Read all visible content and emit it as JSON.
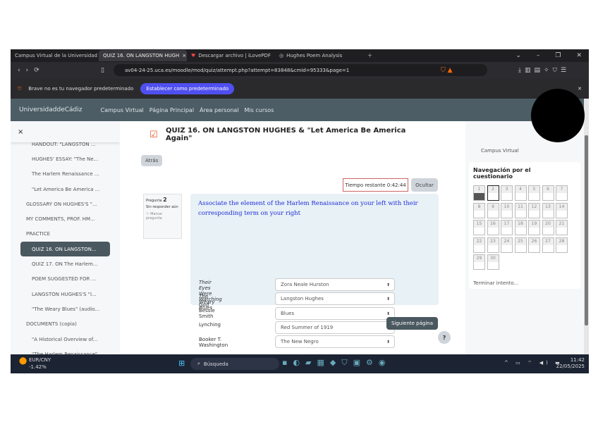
{
  "browser": {
    "tabs": [
      {
        "label": "Campus Virtual de la Universidad d"
      },
      {
        "label": "QUIZ 16. ON LANGSTON HUGH"
      },
      {
        "label": "Descargar archivo | iLovePDF"
      },
      {
        "label": "Hughes Poem Analysis"
      }
    ],
    "url": "av04-24-25.uca.es/moodle/mod/quiz/attempt.php?attempt=83848&cmid=95333&page=1",
    "infobar_text": "Brave no es tu navegador predeterminado",
    "infobar_button": "Establecer como predeterminado"
  },
  "navbar": {
    "brand": "UniversidaddeCádiz",
    "links": [
      "Campus Virtual",
      "Página Principal",
      "Área personal",
      "Mis cursos"
    ]
  },
  "sidebar": {
    "items": [
      {
        "label": "HANDOUT: \"LANGSTON ..."
      },
      {
        "label": "HUGHES' ESSAY: \"The Ne..."
      },
      {
        "label": "The Harlem Renaissance ..."
      },
      {
        "label": "\"Let America Be America ..."
      },
      {
        "label": "GLOSSARY ON HUGHES'S \"..."
      },
      {
        "label": "MY COMMENTS, PROF. HM..."
      },
      {
        "label": "PRACTICE"
      },
      {
        "label": "QUIZ 16. ON LANGSTON..."
      },
      {
        "label": "QUIZ 17. ON The Harlem..."
      },
      {
        "label": "POEM SUGGESTED FOR ..."
      },
      {
        "label": "LANGSTON HUGHES'S \"I..."
      },
      {
        "label": "\"The Weary Blues\" (audio..."
      },
      {
        "label": "DOCUMENTS (copia)"
      },
      {
        "label": "\"A Historical Overview of..."
      },
      {
        "label": "\"The Harlem Renaissance\"..."
      }
    ]
  },
  "quiz": {
    "title": "QUIZ 16. ON LANGSTON HUGHES & \"Let America Be America Again\"",
    "back": "Atrás",
    "timer": "Tiempo restante 0:42:44",
    "hide": "Ocultar",
    "question_label": "Pregunta",
    "question_number": "2",
    "status": "Sin responder aún",
    "flag": "Marcar pregunta",
    "prompt": "Associate the element of the Harlem Renaissance on your left with their corresponding term on your right",
    "rows": [
      {
        "left": "Their Eyes Were Watching God",
        "right": "Zora Neale Hurston"
      },
      {
        "left": "The Weary Blues",
        "right": "Langston Hughes"
      },
      {
        "left": "Bessie Smith",
        "right": "Blues"
      },
      {
        "left": "Lynching",
        "right": "Red Summer of 1919"
      },
      {
        "left": "Booker T. Washington",
        "right": "The New Negro"
      }
    ],
    "next": "Siguiente página",
    "help": "?"
  },
  "right": {
    "campus": "Campus Virtual",
    "nav_title": "Navegación por el cuestionario",
    "numbers": [
      "1",
      "2",
      "3",
      "4",
      "5",
      "6",
      "7",
      "8",
      "9",
      "10",
      "11",
      "12",
      "13",
      "14",
      "15",
      "16",
      "17",
      "18",
      "19",
      "20",
      "21",
      "22",
      "23",
      "24",
      "25",
      "26",
      "27",
      "28",
      "29",
      "30"
    ],
    "finish": "Terminar intento..."
  },
  "taskbar": {
    "weather": "EUR/CNY",
    "weather_value": "-1.42%",
    "search": "Búsqueda",
    "time": "11:42",
    "date": "22/05/2025"
  }
}
